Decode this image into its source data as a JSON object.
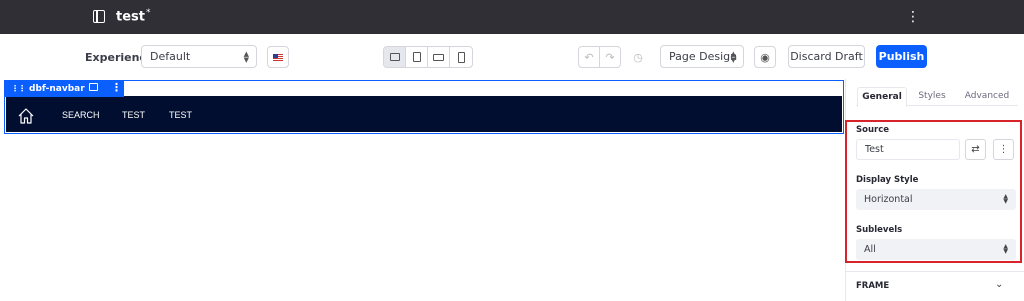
{
  "topbar": {
    "title": "test",
    "unsaved_marker": "*",
    "icons": {
      "sidebar_toggle": "sidebar-toggle-icon",
      "options": "kebab-icon"
    }
  },
  "toolbar": {
    "experience_label": "Experience",
    "experience_value": "Default",
    "language_icon": "us-flag-icon",
    "devices": [
      {
        "name": "desktop",
        "active": true
      },
      {
        "name": "tablet",
        "active": false
      },
      {
        "name": "landscape-phone",
        "active": false
      },
      {
        "name": "portrait-phone",
        "active": false
      }
    ],
    "undo_icon": "undo-icon",
    "redo_icon": "redo-icon",
    "history_icon": "history-icon",
    "mode_value": "Page Design",
    "preview_icon": "eye-icon",
    "discard_label": "Discard Draft",
    "publish_label": "Publish"
  },
  "canvas": {
    "fragment": {
      "name": "dbf-navbar",
      "icons": {
        "drag": "drag-handle-icon",
        "comment": "comment-icon",
        "options": "kebab-icon"
      }
    },
    "navbar": {
      "home_icon": "home-icon",
      "links": [
        "SEARCH",
        "TEST",
        "TEST"
      ]
    }
  },
  "sidebar": {
    "tabs": [
      {
        "label": "General",
        "active": true
      },
      {
        "label": "Styles",
        "active": false
      },
      {
        "label": "Advanced",
        "active": false
      }
    ],
    "source": {
      "label": "Source",
      "value": "Test"
    },
    "display_style": {
      "label": "Display Style",
      "value": "Horizontal"
    },
    "sublevels": {
      "label": "Sublevels",
      "value": "All"
    },
    "frame_label": "FRAME"
  },
  "colors": {
    "topbar_bg": "#2f2f35",
    "primary": "#0b5fff",
    "navbar_bg": "#020e2f",
    "highlight_border": "#d7242b"
  }
}
